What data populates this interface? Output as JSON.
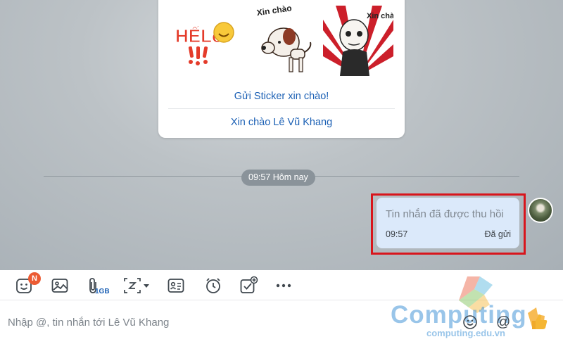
{
  "sticker_card": {
    "stickers": [
      "hello-sticker",
      "xin-chao-dog-sticker",
      "xin-chao-guy-sticker"
    ],
    "sticker_texts": {
      "s1": "HẾLô",
      "s2": "Xin chào",
      "s3": "Xin chào"
    },
    "action_send_sticker": "Gửi Sticker xin chào!",
    "action_greet": "Xin chào Lê Vũ Khang"
  },
  "timeline": {
    "separator_time": "09:57 Hôm nay"
  },
  "message": {
    "text": "Tin nhắn đã được thu hồi",
    "time": "09:57",
    "status": "Đã gửi"
  },
  "toolbar": {
    "emoji_badge": "N",
    "file_size_label": "1GB",
    "items": [
      "sticker-icon",
      "image-icon",
      "attach-icon",
      "screenshot-icon",
      "contact-card-icon",
      "reminder-icon",
      "todo-icon",
      "more-icon"
    ]
  },
  "input": {
    "placeholder": "Nhập @, tin nhắn tới Lê Vũ Khang"
  },
  "watermark": {
    "word": "Computing",
    "url": "computing.edu.vn"
  },
  "colors": {
    "link": "#1a5fb4",
    "bubble": "#dbe9fa",
    "highlight": "#d8151c",
    "badge": "#ec5b33"
  }
}
